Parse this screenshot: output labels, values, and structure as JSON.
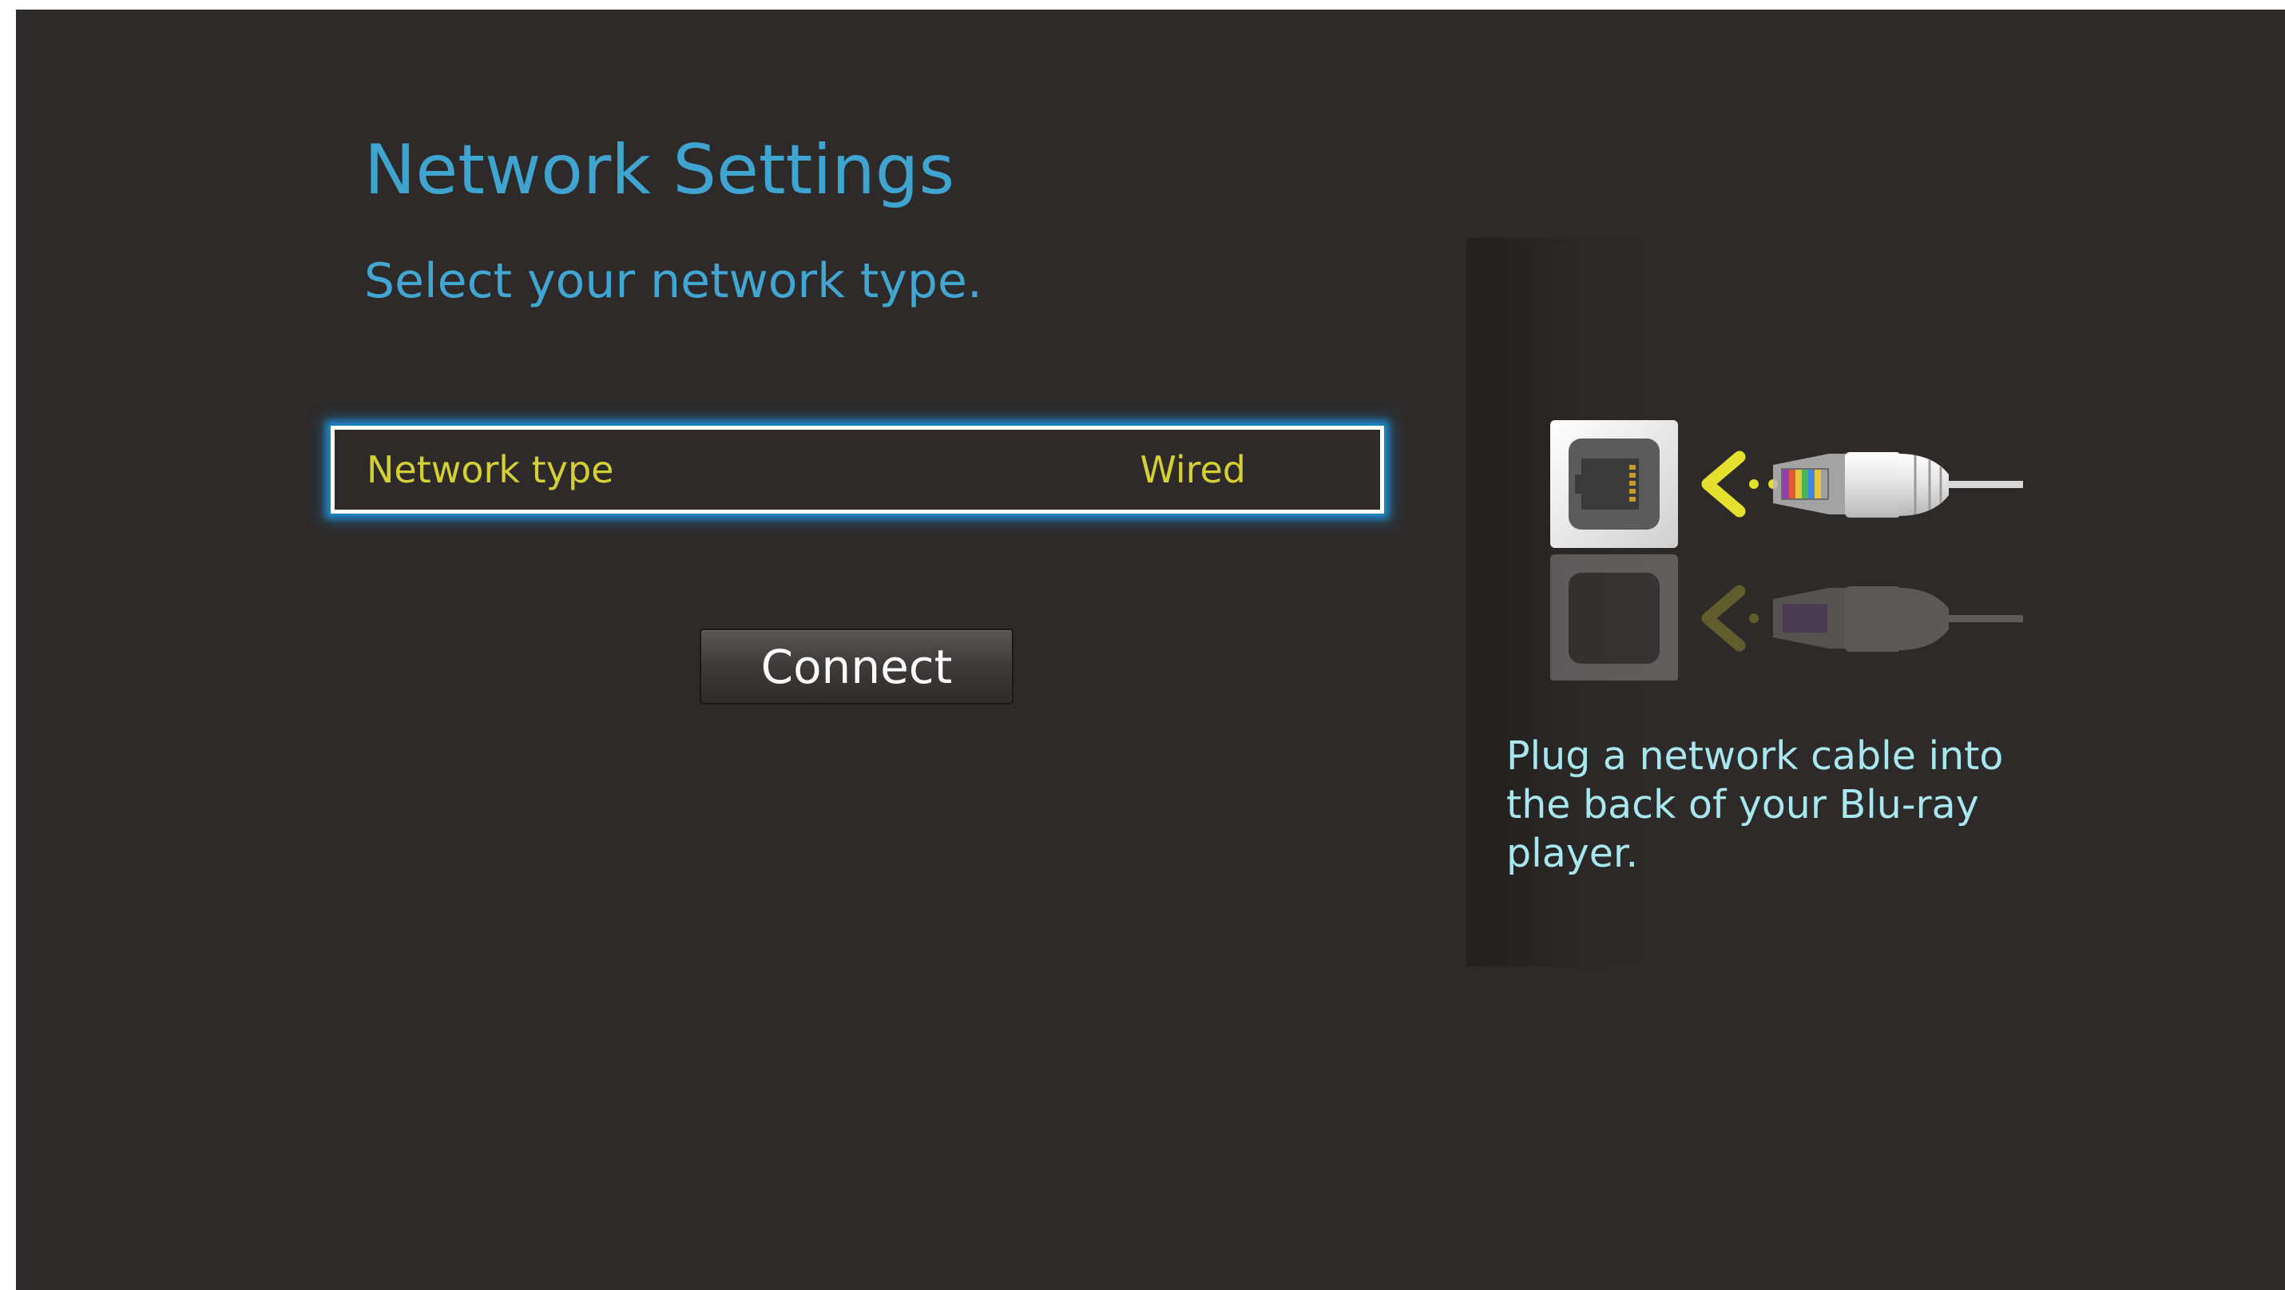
{
  "page": {
    "title": "Network Settings",
    "subtitle": "Select your network type."
  },
  "network_type": {
    "label": "Network type",
    "value": "Wired"
  },
  "connect_button": {
    "label": "Connect"
  },
  "help": {
    "text": "Plug a network cable into\nthe back of your Blu-ray\nplayer."
  },
  "icons": {
    "illustration": "network-cable-into-port-icon",
    "arrow": "chevron-left-icon"
  },
  "colors": {
    "background": "#2e2a2a",
    "title": "#3fa4cf",
    "selection_glow": "#1f86c7",
    "row_text": "#d4cf35",
    "help_text": "#a7e7ed"
  }
}
